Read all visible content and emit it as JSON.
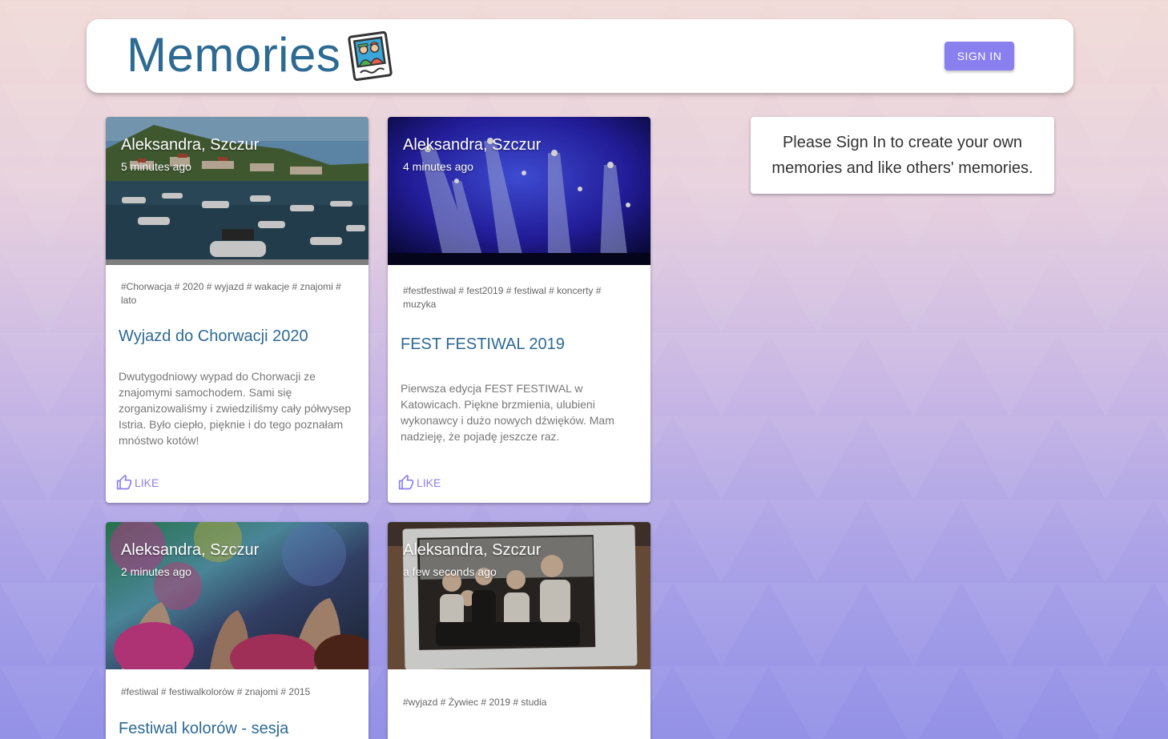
{
  "header": {
    "title": "Memories",
    "logo_icon": "photo-memories-icon",
    "sign_in_label": "SIGN IN",
    "accent_color": "#8a7fef",
    "title_color": "#2d6a93"
  },
  "notice": {
    "text": "Please Sign In to create your own memories and like others' memories."
  },
  "posts": [
    {
      "author": "Aleksandra, Szczur",
      "time": "5 minutes ago",
      "tags": "#Chorwacja # 2020 # wyjazd # wakacje # znajomi # lato",
      "title": "Wyjazd do Chorwacji 2020",
      "message": "Dwutygodniowy wypad do Chorwacji ze znajomymi samochodem. Sami się zorganizowaliśmy i zwiedziliśmy cały półwysep Istria. Było ciepło, pięknie i do tego poznałam mnóstwo kotów!",
      "like_label": "LIKE",
      "image": "harbor-boats"
    },
    {
      "author": "Aleksandra, Szczur",
      "time": "4 minutes ago",
      "tags": "#festfestiwal # fest2019 # festiwal # koncerty # muzyka",
      "title": "FEST FESTIWAL 2019",
      "message": "Pierwsza edycja FEST FESTIWAL w Katowicach. Piękne brzmienia, ulubieni wykonawcy i dużo nowych dźwięków. Mam nadzieję, że pojadę jeszcze raz.",
      "like_label": "LIKE",
      "image": "concert-lights"
    },
    {
      "author": "Aleksandra, Szczur",
      "time": "2 minutes ago",
      "tags": "#festiwal # festiwalkolorów # znajomi # 2015",
      "title": "Festiwal kolorów - sesja",
      "image": "color-festival"
    },
    {
      "author": "Aleksandra, Szczur",
      "time": "a few seconds ago",
      "tags": "#wyjazd # Żywiec # 2019 # studia",
      "image": "polaroid-friends"
    }
  ]
}
